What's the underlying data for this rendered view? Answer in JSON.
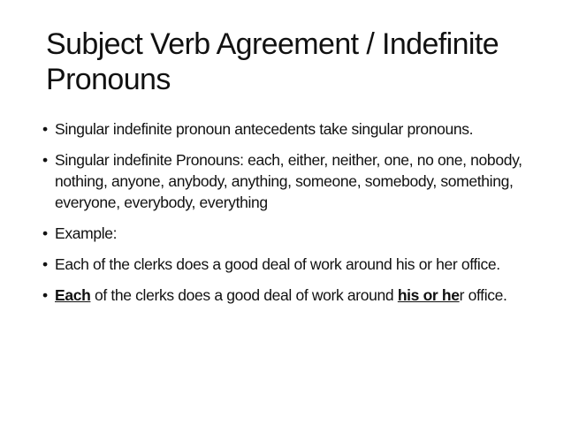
{
  "slide": {
    "title": "Subject Verb Agreement / Indefinite Pronouns",
    "bullet_char": "•",
    "bullets": [
      {
        "text": "Singular indefinite pronoun antecedents take singular pronouns."
      },
      {
        "text": "Singular indefinite Pronouns:  each, either, neither, one, no one, nobody, nothing, anyone, anybody, anything, someone, somebody, something, everyone, everybody, everything"
      },
      {
        "text": "Example:"
      },
      {
        "text": "Each of the clerks does a good deal of work around his or her office."
      },
      {
        "seg1": "Each",
        "seg2": " of the clerks does a good deal of work around ",
        "seg3": "his or he",
        "seg4": "r office."
      }
    ]
  }
}
